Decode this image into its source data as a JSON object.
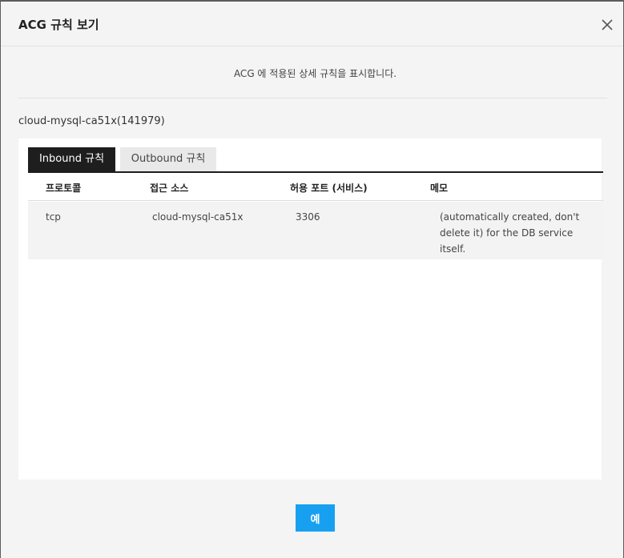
{
  "modal": {
    "title": "ACG 규칙 보기",
    "description": "ACG 에 적용된 상세 규칙을 표시합니다.",
    "resource_name": "cloud-mysql-ca51x(141979)",
    "ok_label": "예"
  },
  "tabs": [
    {
      "label": "Inbound 규칙",
      "active": true
    },
    {
      "label": "Outbound 규칙",
      "active": false
    }
  ],
  "table": {
    "columns": [
      "프로토콜",
      "접근 소스",
      "허용 포트 (서비스)",
      "메모"
    ],
    "rows": [
      {
        "protocol": "tcp",
        "source": "cloud-mysql-ca51x",
        "port": "3306",
        "memo": "(automatically created, don't delete it) for the DB service itself."
      }
    ]
  },
  "icons": {
    "close": "close-icon"
  }
}
